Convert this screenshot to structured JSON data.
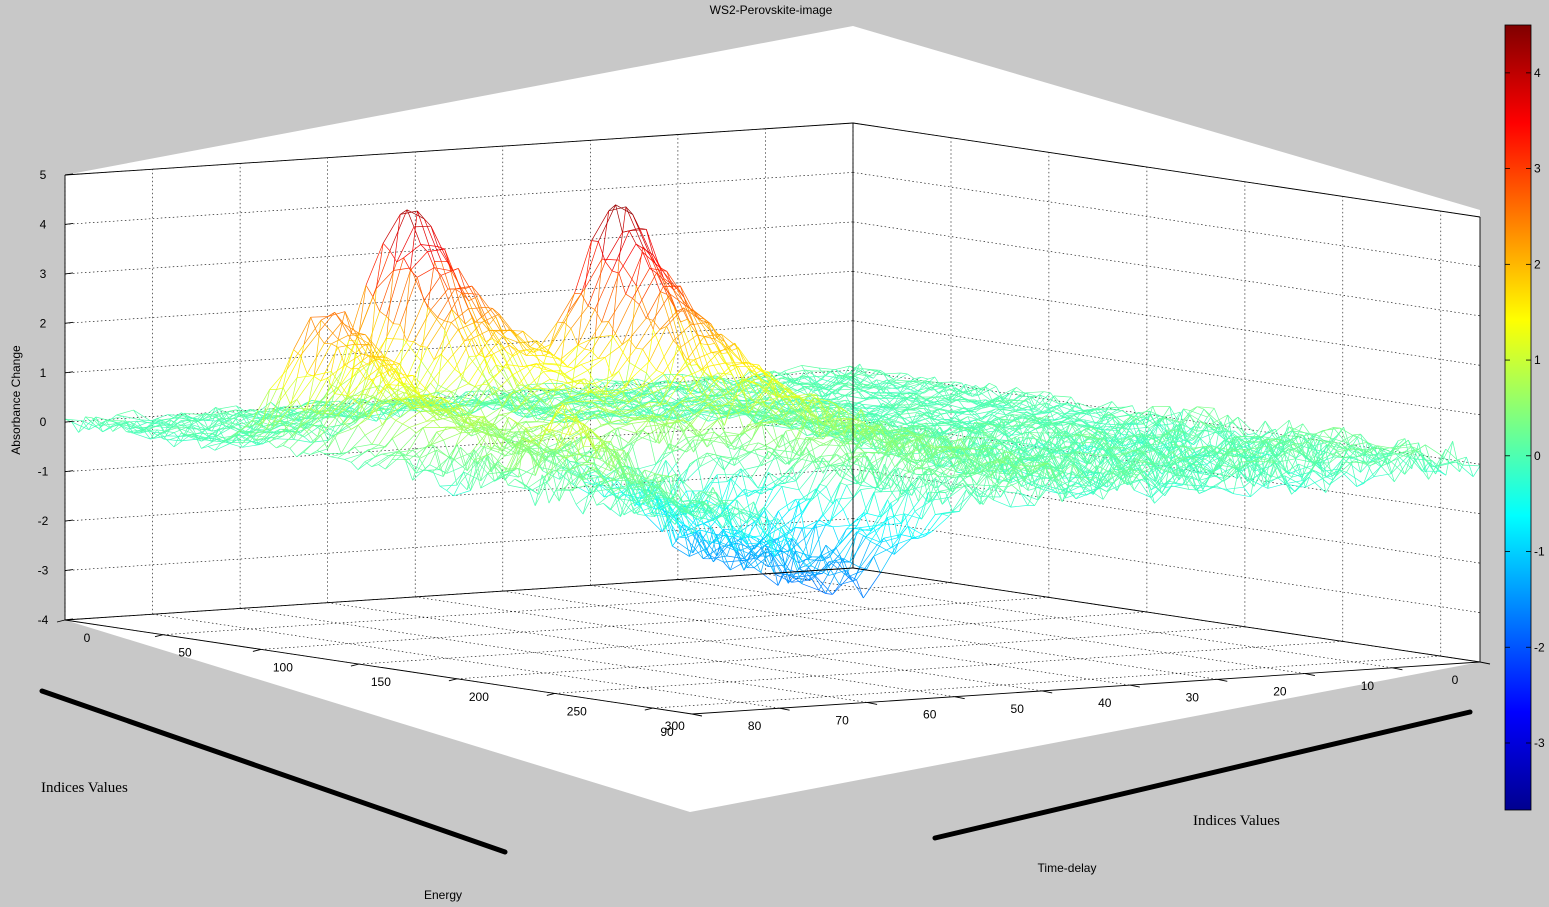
{
  "figure": {
    "background": "#c8c8c8",
    "plot_background": "#ffffff"
  },
  "chart_data": {
    "type": "surface-mesh",
    "title": "WS2-Perovskite-image",
    "xlabel": "Energy",
    "ylabel": "Time-delay",
    "zlabel": "Absorbance Change",
    "energy_axis": {
      "range": [
        0,
        90
      ],
      "ticks": [
        "0",
        "10",
        "20",
        "30",
        "40",
        "50",
        "60",
        "70",
        "80",
        "90"
      ]
    },
    "time_axis": {
      "range": [
        0,
        320
      ],
      "ticks": [
        "0",
        "50",
        "100",
        "150",
        "200",
        "250",
        "300"
      ]
    },
    "z_axis": {
      "range": [
        -4,
        5
      ],
      "ticks": [
        "-4",
        "-3",
        "-2",
        "-1",
        "0",
        "1",
        "2",
        "3",
        "4",
        "5"
      ]
    },
    "colorbar": {
      "colormap": "jet",
      "range": [
        -3.7,
        4.5
      ],
      "ticks": [
        "4",
        "3",
        "2",
        "1",
        "0",
        "-1",
        "-2",
        "-3"
      ]
    },
    "grid": true,
    "peaks": [
      {
        "energy": 62,
        "time": 50,
        "height": 4.4
      },
      {
        "energy": 48,
        "time": 95,
        "height": 4.6
      },
      {
        "energy": 80,
        "time": 90,
        "height": 2.7
      },
      {
        "energy": 80,
        "time": 215,
        "height": 1.5
      }
    ]
  },
  "annotations": {
    "left": "Indices Values",
    "right": "Indices Values"
  }
}
